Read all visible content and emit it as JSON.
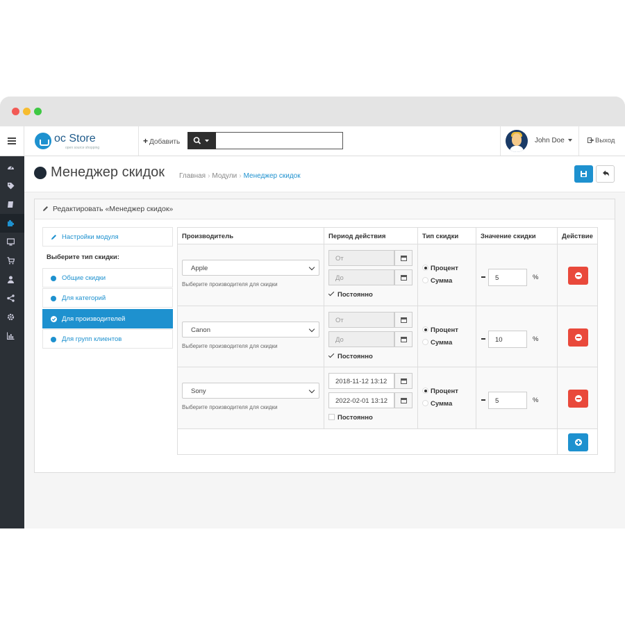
{
  "header": {
    "logo_text": "oc Store",
    "logo_subtitle": "open source shopping",
    "add_label": "Добавить",
    "search_placeholder": "",
    "user_name": "John Doe",
    "logout_label": "Выход"
  },
  "page": {
    "title": "Менеджер скидок",
    "breadcrumb": [
      "Главная",
      "Модули",
      "Менеджер скидок"
    ]
  },
  "panel": {
    "heading": "Редактировать «Менеджер скидок»"
  },
  "left_menu": {
    "settings_label": "Настройки модуля",
    "section_label": "Выберите тип скидки:",
    "items": [
      "Общие скидки",
      "Для категорий",
      "Для производителей",
      "Для групп клиентов"
    ],
    "active_index": 2
  },
  "table": {
    "columns": [
      "Производитель",
      "Период действия",
      "Тип скидки",
      "Значение скидки",
      "Действие"
    ],
    "manufacturer_help": "Выберите производителя для скидки",
    "permanent_label": "Постоянно",
    "percent_label": "Процент",
    "sum_label": "Сумма",
    "unit": "%",
    "rows": [
      {
        "manufacturer": "Apple",
        "date_from": "",
        "date_to": "",
        "date_from_placeholder": "От",
        "date_to_placeholder": "До",
        "permanent": true,
        "type": "percent",
        "value": "5"
      },
      {
        "manufacturer": "Canon",
        "date_from": "",
        "date_to": "",
        "date_from_placeholder": "От",
        "date_to_placeholder": "До",
        "permanent": true,
        "type": "percent",
        "value": "10"
      },
      {
        "manufacturer": "Sony",
        "date_from": "2018-11-12 13:12",
        "date_to": "2022-02-01 13:12",
        "date_from_placeholder": "От",
        "date_to_placeholder": "До",
        "permanent": false,
        "type": "percent",
        "value": "5"
      }
    ]
  },
  "icons": {
    "sidebar": [
      "dashboard-icon",
      "tag-icon",
      "book-icon",
      "puzzle-icon",
      "desktop-icon",
      "cart-icon",
      "user-icon",
      "share-icon",
      "gear-icon",
      "bar-chart-icon"
    ]
  },
  "colors": {
    "accent": "#1e91cf",
    "danger": "#e9493b",
    "sidebar": "#2b3036"
  }
}
